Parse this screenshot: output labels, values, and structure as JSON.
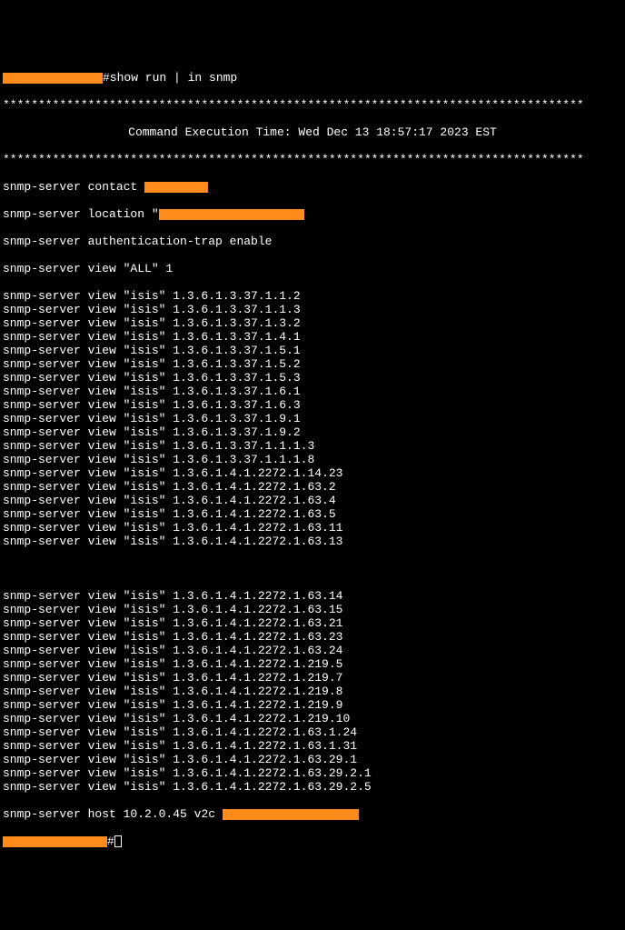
{
  "prompt_redact1_width": 110,
  "command": "#show run | in snmp",
  "sep_line": "**********************************************************************************",
  "exec_time": "Command Execution Time: Wed Dec 13 18:57:17 2023 EST",
  "contact_prefix": "snmp-server contact ",
  "contact_redact_width": 70,
  "location_prefix": "snmp-server location \"",
  "location_redact_width": 160,
  "auth_trap": "snmp-server authentication-trap enable",
  "view_all": "snmp-server view \"ALL\" 1",
  "isis_lines": [
    "snmp-server view \"isis\" 1.3.6.1.3.37.1.1.2",
    "snmp-server view \"isis\" 1.3.6.1.3.37.1.1.3",
    "snmp-server view \"isis\" 1.3.6.1.3.37.1.3.2",
    "snmp-server view \"isis\" 1.3.6.1.3.37.1.4.1",
    "snmp-server view \"isis\" 1.3.6.1.3.37.1.5.1",
    "snmp-server view \"isis\" 1.3.6.1.3.37.1.5.2",
    "snmp-server view \"isis\" 1.3.6.1.3.37.1.5.3",
    "snmp-server view \"isis\" 1.3.6.1.3.37.1.6.1",
    "snmp-server view \"isis\" 1.3.6.1.3.37.1.6.3",
    "snmp-server view \"isis\" 1.3.6.1.3.37.1.9.1",
    "snmp-server view \"isis\" 1.3.6.1.3.37.1.9.2",
    "snmp-server view \"isis\" 1.3.6.1.3.37.1.1.1.3",
    "snmp-server view \"isis\" 1.3.6.1.3.37.1.1.1.8",
    "snmp-server view \"isis\" 1.3.6.1.4.1.2272.1.14.23",
    "snmp-server view \"isis\" 1.3.6.1.4.1.2272.1.63.2",
    "snmp-server view \"isis\" 1.3.6.1.4.1.2272.1.63.4",
    "snmp-server view \"isis\" 1.3.6.1.4.1.2272.1.63.5",
    "snmp-server view \"isis\" 1.3.6.1.4.1.2272.1.63.11",
    "snmp-server view \"isis\" 1.3.6.1.4.1.2272.1.63.13"
  ],
  "isis_lines_2": [
    "snmp-server view \"isis\" 1.3.6.1.4.1.2272.1.63.14",
    "snmp-server view \"isis\" 1.3.6.1.4.1.2272.1.63.15",
    "snmp-server view \"isis\" 1.3.6.1.4.1.2272.1.63.21",
    "snmp-server view \"isis\" 1.3.6.1.4.1.2272.1.63.23",
    "snmp-server view \"isis\" 1.3.6.1.4.1.2272.1.63.24",
    "snmp-server view \"isis\" 1.3.6.1.4.1.2272.1.219.5",
    "snmp-server view \"isis\" 1.3.6.1.4.1.2272.1.219.7",
    "snmp-server view \"isis\" 1.3.6.1.4.1.2272.1.219.8",
    "snmp-server view \"isis\" 1.3.6.1.4.1.2272.1.219.9",
    "snmp-server view \"isis\" 1.3.6.1.4.1.2272.1.219.10",
    "snmp-server view \"isis\" 1.3.6.1.4.1.2272.1.63.1.24",
    "snmp-server view \"isis\" 1.3.6.1.4.1.2272.1.63.1.31",
    "snmp-server view \"isis\" 1.3.6.1.4.1.2272.1.63.29.1",
    "snmp-server view \"isis\" 1.3.6.1.4.1.2272.1.63.29.2.1",
    "snmp-server view \"isis\" 1.3.6.1.4.1.2272.1.63.29.2.5"
  ],
  "host_prefix": "snmp-server host ",
  "host_ip": "10.2.0.45",
  "host_mid": " v2c ",
  "host_redact_width": 150,
  "final_redact_width": 115,
  "final_hash": "#"
}
